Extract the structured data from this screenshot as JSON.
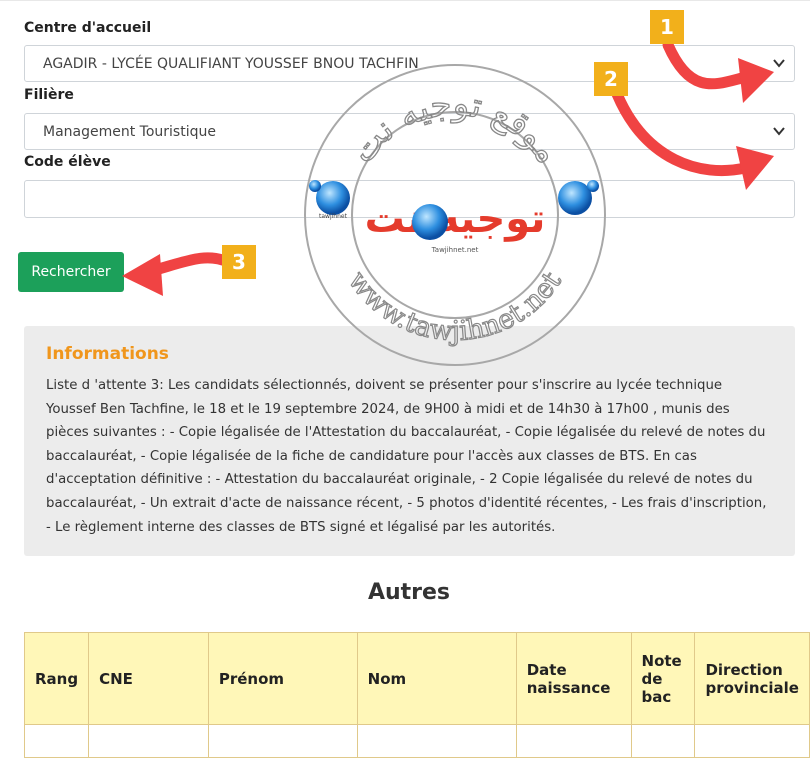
{
  "form": {
    "centre_label": "Centre d'accueil",
    "centre_value": "AGADIR - LYCÉE QUALIFIANT YOUSSEF BNOU TACHFIN",
    "filiere_label": "Filière",
    "filiere_value": "Management Touristique",
    "code_label": "Code élève",
    "code_value": "",
    "search_button": "Rechercher"
  },
  "info": {
    "title": "Informations",
    "text": "Liste d 'attente 3: Les candidats sélectionnés, doivent se présenter pour s'inscrire au lycée technique Youssef Ben Tachfine, le 18 et le 19 septembre 2024, de 9H00 à midi et de 14h30 à 17h00 , munis des pièces suivantes : - Copie légalisée de l'Attestation du baccalauréat, - Copie légalisée du relevé de notes du baccalauréat, - Copie légalisée de la fiche de candidature pour l'accès aux classes de BTS. En cas d'acceptation définitive : - Attestation du baccalauréat originale, - 2 Copie légalisée du relevé de notes du baccalauréat, - Un extrait d'acte de naissance récent, - 5 photos d'identité récentes, - Les frais d'inscription, - Le règlement interne des classes de BTS signé et légalisé par les autorités."
  },
  "section_title": "Autres",
  "table": {
    "headers": [
      "Rang",
      "CNE",
      "Prénom",
      "Nom",
      "Date naissance",
      "Note de bac",
      "Direction provinciale"
    ]
  },
  "annotations": {
    "badge_1": "1",
    "badge_2": "2",
    "badge_3": "3",
    "color_arrow": "#f04343",
    "color_badge": "#f2b01b"
  },
  "watermark": {
    "arabic_top": "موقع توجيه نت",
    "center_text": "توجيه نت",
    "ring_text": "www.tawjihnet.net",
    "small_1": "tawjihnet",
    "small_2": "Tawjihnet.net"
  }
}
